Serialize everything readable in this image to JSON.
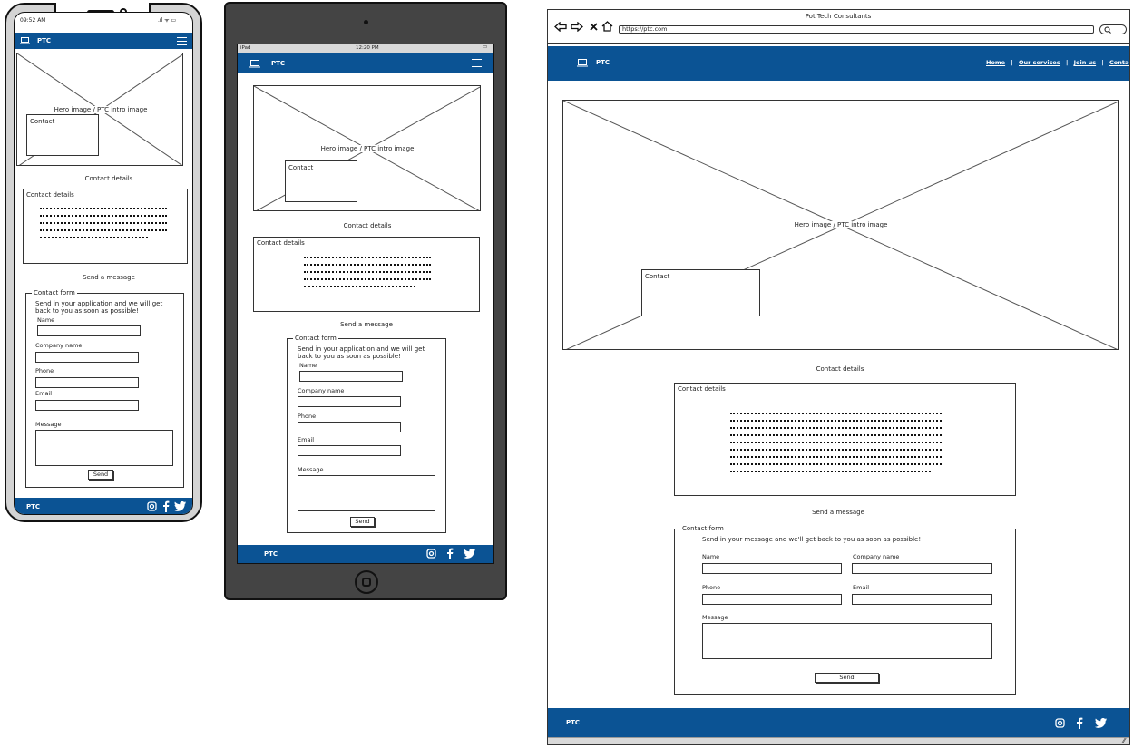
{
  "phone": {
    "time": "09:52 AM",
    "brand": "PTC",
    "hero_label": "Hero image / PTC intro image",
    "contact_overlay": "Contact",
    "contact_details_heading": "Contact details",
    "contact_details_box_title": "Contact details",
    "send_message_heading": "Send a message",
    "form_legend": "Contact form",
    "form_intro": "Send in your application and we will get back to you as soon as possible!",
    "field_name": "Name",
    "field_company": "Company name",
    "field_phone": "Phone",
    "field_email": "Email",
    "field_message": "Message",
    "send_label": "Send",
    "footer_brand": "PTC"
  },
  "tablet": {
    "status_left": "iPad",
    "status_time": "12:20 PM",
    "brand": "PTC",
    "hero_label": "Hero image / PTC intro image",
    "contact_overlay": "Contact",
    "contact_details_heading": "Contact details",
    "contact_details_box_title": "Contact details",
    "send_message_heading": "Send a message",
    "form_legend": "Contact form",
    "form_intro": "Send in your application and we will get back to you as soon as possible!",
    "field_name": "Name",
    "field_company": "Company name",
    "field_phone": "Phone",
    "field_email": "Email",
    "field_message": "Message",
    "send_label": "Send",
    "footer_brand": "PTC"
  },
  "desktop": {
    "window_title": "Pot Tech Consultants",
    "url": "https://ptc.com",
    "brand": "PTC",
    "nav": [
      "Home",
      "Our services",
      "Join us",
      "Contact"
    ],
    "hero_label": "Hero image / PTC intro image",
    "contact_overlay": "Contact",
    "contact_details_heading": "Contact details",
    "contact_details_box_title": "Contact details",
    "send_message_heading": "Send a message",
    "form_legend": "Contact form",
    "form_intro": "Send in your message and we'll get back to you as soon as possible!",
    "field_name": "Name",
    "field_company": "Company name",
    "field_phone": "Phone",
    "field_email": "Email",
    "field_message": "Message",
    "send_label": "Send",
    "footer_brand": "PTC"
  },
  "colors": {
    "brand_blue": "#0b5394"
  },
  "icons": [
    "laptop-icon",
    "hamburger-icon",
    "instagram-icon",
    "facebook-icon",
    "twitter-icon",
    "back-arrow-icon",
    "forward-arrow-icon",
    "close-icon",
    "home-icon",
    "search-icon"
  ]
}
